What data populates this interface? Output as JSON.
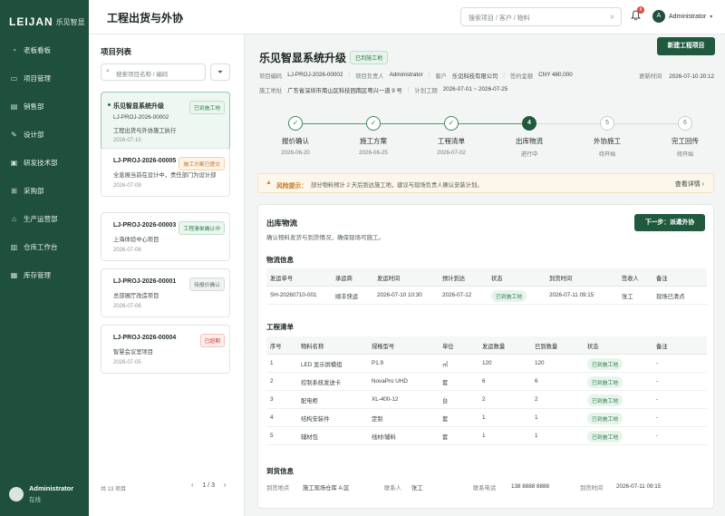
{
  "sidebar": {
    "logo_main": "LEIJAN",
    "logo_sub": "乐见智显",
    "items": [
      {
        "label": "老板看板",
        "icon": "dashboard-icon",
        "glyph": "◔"
      },
      {
        "label": "项目管理",
        "icon": "folder-icon",
        "glyph": "▭"
      },
      {
        "label": "销售部",
        "icon": "clipboard-icon",
        "glyph": "▤"
      },
      {
        "label": "设计部",
        "icon": "pen-icon",
        "glyph": "✎"
      },
      {
        "label": "研发技术部",
        "icon": "code-icon",
        "glyph": "▣"
      },
      {
        "label": "采购部",
        "icon": "cart-icon",
        "glyph": "⊞"
      },
      {
        "label": "生产运营部",
        "icon": "factory-icon",
        "glyph": "⌂"
      },
      {
        "label": "仓库工作台",
        "icon": "warehouse-icon",
        "glyph": "▥"
      },
      {
        "label": "库存管理",
        "icon": "box-icon",
        "glyph": "▦"
      }
    ],
    "user_name": "Administrator",
    "user_status": "在线"
  },
  "topbar": {
    "title": "工程出货与外协",
    "search_placeholder": "搜索项目 / 客户 / 物料",
    "notif_count": "8",
    "user_initial": "A",
    "user_name": "Administrator"
  },
  "plist": {
    "title": "项目列表",
    "search_placeholder": "搜索项目名称 / 编码",
    "total": "共 13 项目",
    "page": "1 / 3",
    "cards": [
      {
        "name": "乐见智显系统升级",
        "code": "LJ-PROJ-2026-00002",
        "desc": "工程出货与外协施工执行",
        "date": "2026-07-10",
        "tag": "已到施工地",
        "tagc": "g"
      },
      {
        "code": "LJ-PROJ-2026-00005",
        "desc": "全息展当前在设计中，责任部门为设计部",
        "date": "2026-07-09",
        "tag": "施工方案已提交",
        "tagc": "o"
      },
      {
        "code": "LJ-PROJ-2026-00003",
        "desc": "上海体验中心项目",
        "date": "2026-07-08",
        "tag": "工程清单确认中",
        "tagc": "g"
      },
      {
        "code": "LJ-PROJ-2026-00001",
        "desc": "总部展厅改造项目",
        "date": "2026-07-06",
        "tag": "待报价确认",
        "tagc": "gy"
      },
      {
        "code": "LJ-PROJ-2026-00004",
        "desc": "智慧会议室项目",
        "date": "2026-07-05",
        "tag": "已超期",
        "tagc": "r"
      }
    ]
  },
  "detail": {
    "title": "乐见智显系统升级",
    "status": "已到施工地",
    "new_btn": "新建工程项目",
    "meta1": {
      "k1": "项目编码",
      "v1": "LJ-PROJ-2026-00002",
      "k2": "项目负责人",
      "v2": "Administrator",
      "k3": "客户",
      "v3": "乐见科技有限公司",
      "k4": "签约金额",
      "v4": "CNY 480,000"
    },
    "meta2": {
      "k1": "施工地址",
      "v1": "广东省深圳市南山区科技园南区粤兴一道 9 号",
      "k2": "计划工期",
      "v2": "2026-07-01 ~ 2026-07-25"
    },
    "update_k": "更新时间",
    "update_v": "2026-07-10 20:12",
    "steps": [
      {
        "title": "报价确认",
        "date": "2026-06-20",
        "mark": "✓",
        "state": "done"
      },
      {
        "title": "施工方案",
        "date": "2026-06-25",
        "mark": "✓",
        "state": "done"
      },
      {
        "title": "工程清单",
        "date": "2026-07-02",
        "mark": "✓",
        "state": "done"
      },
      {
        "title": "出库物流",
        "date": "进行中",
        "mark": "4",
        "state": "cur"
      },
      {
        "title": "外协施工",
        "date": "待开始",
        "mark": "5",
        "state": "todo"
      },
      {
        "title": "完工回传",
        "date": "待开始",
        "mark": "6",
        "state": "todo"
      }
    ],
    "warn_title": "风险提示：",
    "warn_msg": "部分物料预计 2 天后到达施工地，建议与现场负责人确认安装计划。",
    "warn_link": "查看详情",
    "panel_title": "出库物流",
    "panel_desc": "确认物料发货与到货情况，确保现场可施工。",
    "next_btn": "下一步：派遣外协",
    "logistics_title": "物流信息",
    "logistics_head": [
      "发运单号",
      "承运商",
      "发运时间",
      "预计到达",
      "状态",
      "到货时间",
      "签收人",
      "备注"
    ],
    "logistics_row": [
      "SH-20260710-001",
      "顺丰快运",
      "2026-07-10 10:30",
      "2026-07-12",
      "已到施工地",
      "2026-07-11 09:15",
      "张工",
      "现场已清点"
    ],
    "bom_title": "工程清单",
    "bom_head": [
      "序号",
      "物料名称",
      "规格型号",
      "单位",
      "发运数量",
      "已到数量",
      "状态",
      "备注"
    ],
    "bom_rows": [
      [
        "1",
        "LED 显示屏模组",
        "P1.9",
        "㎡",
        "120",
        "120",
        "已到施工地",
        "-"
      ],
      [
        "2",
        "控制系统发送卡",
        "NovaPro UHD",
        "套",
        "6",
        "6",
        "已到施工地",
        "-"
      ],
      [
        "3",
        "配电柜",
        "XL-400-12",
        "台",
        "2",
        "2",
        "已到施工地",
        "-"
      ],
      [
        "4",
        "结构安装件",
        "定制",
        "套",
        "1",
        "1",
        "已到施工地",
        "-"
      ],
      [
        "5",
        "辅材包",
        "线材/辅料",
        "套",
        "1",
        "1",
        "已到施工地",
        "-"
      ]
    ],
    "arrival_title": "到货信息",
    "arrival": {
      "k1": "到货地点",
      "v1": "施工现场仓库 A 区",
      "k2": "联系人",
      "v2": "张工",
      "k3": "联系电话",
      "v3": "138 8888 8888",
      "k4": "到货时间",
      "v4": "2026-07-11 09:15"
    }
  }
}
